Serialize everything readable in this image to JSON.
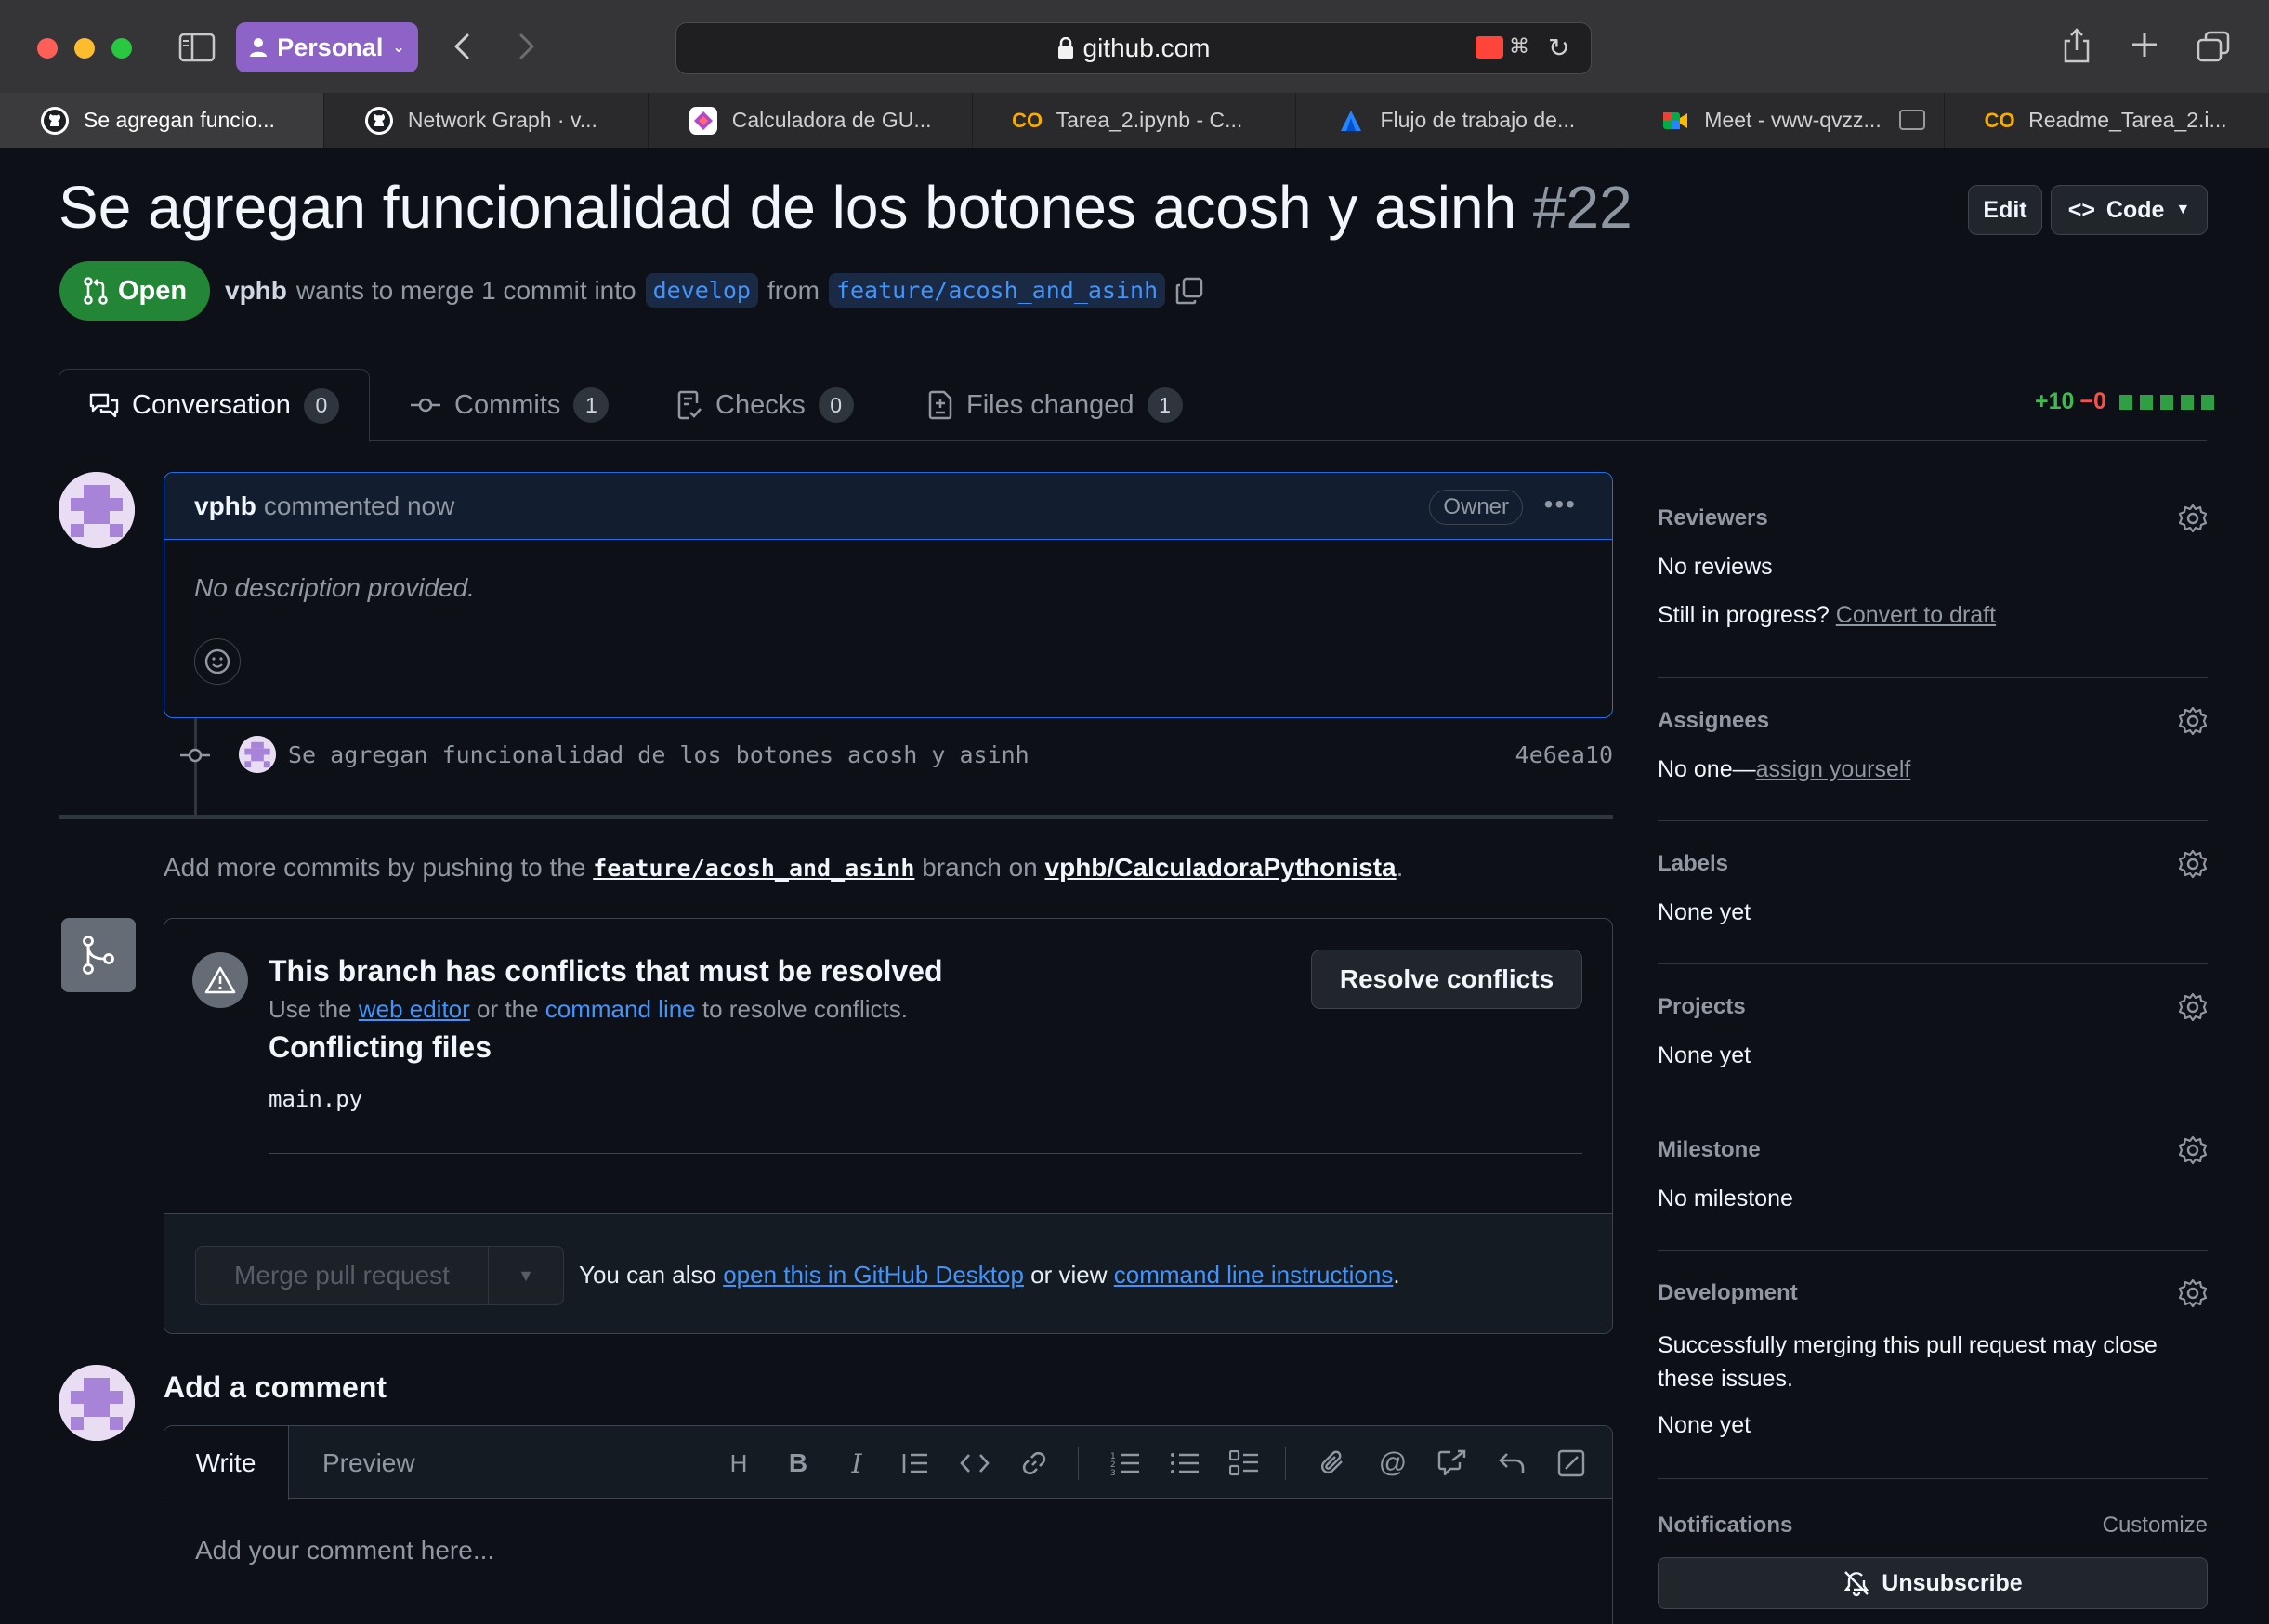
{
  "browser": {
    "profile": "Personal",
    "url": "github.com",
    "tabs": [
      {
        "title": "Se agregan funcio...",
        "icon": "github-icon",
        "active": true
      },
      {
        "title": "Network Graph · v...",
        "icon": "github-icon",
        "active": false
      },
      {
        "title": "Calculadora de GU...",
        "icon": "gui-icon",
        "active": false
      },
      {
        "title": "Tarea_2.ipynb - C...",
        "icon": "colab-icon",
        "active": false
      },
      {
        "title": "Flujo de trabajo de...",
        "icon": "atlassian-icon",
        "active": false
      },
      {
        "title": "Meet - vww-qvzz...",
        "icon": "meet-icon",
        "active": false
      },
      {
        "title": "Readme_Tarea_2.i...",
        "icon": "colab-icon",
        "active": false
      }
    ]
  },
  "pr": {
    "title": "Se agregan funcionalidad de los botones acosh y asinh",
    "number": "#22",
    "edit_label": "Edit",
    "code_label": "Code",
    "state": "Open",
    "author": "vphb",
    "merge_text": "wants to merge 1 commit into",
    "base_branch": "develop",
    "from_text": "from",
    "head_branch": "feature/acosh_and_asinh"
  },
  "tabnav": {
    "conversation": {
      "label": "Conversation",
      "count": "0"
    },
    "commits": {
      "label": "Commits",
      "count": "1"
    },
    "checks": {
      "label": "Checks",
      "count": "0"
    },
    "files": {
      "label": "Files changed",
      "count": "1"
    },
    "additions": "+10",
    "deletions": "−0"
  },
  "comment": {
    "author": "vphb",
    "action": "commented now",
    "badge": "Owner",
    "body": "No description provided."
  },
  "commit": {
    "message": "Se agregan funcionalidad de los botones acosh y asinh",
    "sha": "4e6ea10"
  },
  "push_msg": {
    "prefix": "Add more commits by pushing to the",
    "branch": "feature/acosh_and_asinh",
    "middle": "branch on",
    "repo": "vphb/CalculadoraPythonista",
    "suffix": "."
  },
  "merge": {
    "conflict_title": "This branch has conflicts that must be resolved",
    "sub_use": "Use the",
    "sub_web_editor": "web editor",
    "sub_or": "or the",
    "sub_command_line": "command line",
    "sub_end": "to resolve conflicts.",
    "resolve_label": "Resolve conflicts",
    "conflicting_files_title": "Conflicting files",
    "files": [
      "main.py"
    ],
    "merge_button": "Merge pull request",
    "also_text": "You can also",
    "open_desktop": "open this in GitHub Desktop",
    "or_view": "or view",
    "cli_instructions": "command line instructions",
    "period": "."
  },
  "add_comment": {
    "title": "Add a comment",
    "write_tab": "Write",
    "preview_tab": "Preview",
    "placeholder": "Add your comment here..."
  },
  "sidebar": {
    "reviewers": {
      "heading": "Reviewers",
      "value": "No reviews",
      "progress_text": "Still in progress?",
      "convert_link": "Convert to draft"
    },
    "assignees": {
      "heading": "Assignees",
      "value_prefix": "No one—",
      "assign_link": "assign yourself"
    },
    "labels": {
      "heading": "Labels",
      "value": "None yet"
    },
    "projects": {
      "heading": "Projects",
      "value": "None yet"
    },
    "milestone": {
      "heading": "Milestone",
      "value": "No milestone"
    },
    "development": {
      "heading": "Development",
      "description": "Successfully merging this pull request may close these issues.",
      "value": "None yet"
    },
    "notifications": {
      "heading": "Notifications",
      "customize": "Customize",
      "unsubscribe": "Unsubscribe"
    }
  },
  "colors": {
    "open_green": "#238636",
    "link_blue": "#4493f8",
    "accent_border": "#1f6feb",
    "profile_purple": "#8e63c7"
  }
}
